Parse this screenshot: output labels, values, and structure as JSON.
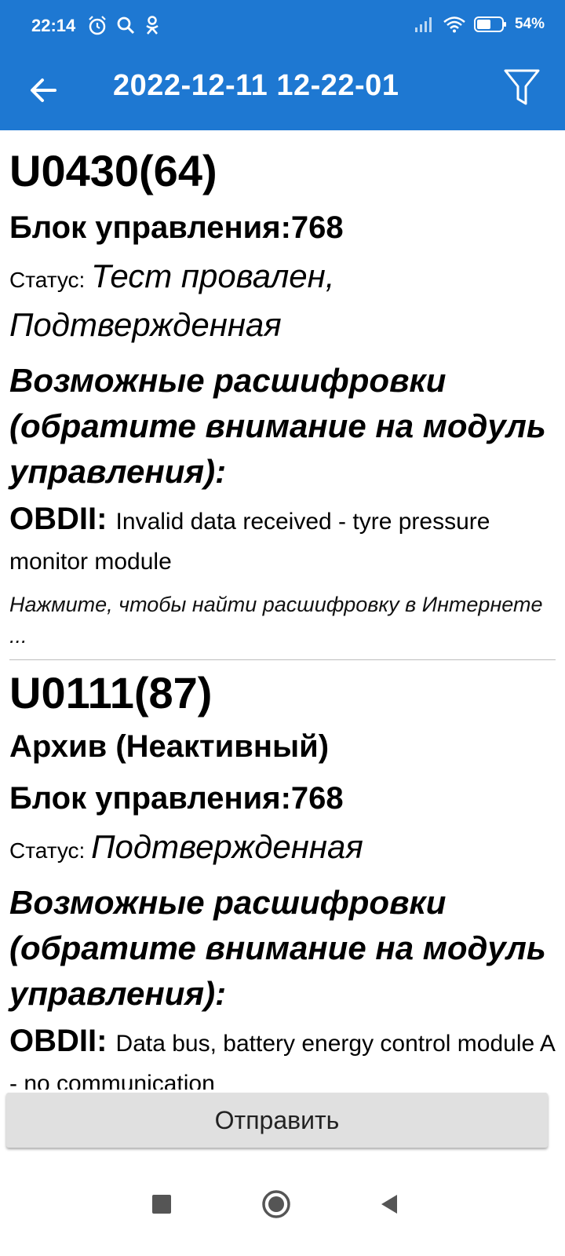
{
  "status_bar": {
    "time": "22:14",
    "battery_percent": "54%",
    "icons_left": [
      "alarm-icon",
      "search-icon",
      "odnoklassniki-icon"
    ],
    "icons_right": [
      "signal-icon",
      "wifi-icon",
      "battery-icon"
    ]
  },
  "app_bar": {
    "title": "2022-12-11 12-22-01",
    "back_icon": "arrow-left-icon",
    "filter_icon": "filter-icon",
    "color": "#1e78d2"
  },
  "entries": [
    {
      "code": "U0430(64)",
      "block": "Блок управления:768",
      "status_label": "Статус: ",
      "status_value": "Тест провален, Подтвержденная",
      "possible_title": "Возможные расшифровки (обратите внимание на модуль управления):",
      "obd_label": "OBDII: ",
      "obd_text": "Invalid data received - tyre pressure monitor module",
      "hint": "Нажмите, чтобы найти расшифровку в Интернете ..."
    },
    {
      "code": "U0111(87)",
      "archive": "Архив (Неактивный)",
      "block": "Блок управления:768",
      "status_label": "Статус: ",
      "status_value": "Подтвержденная",
      "possible_title": "Возможные расшифровки (обратите внимание на модуль управления):",
      "obd_label": "OBDII: ",
      "obd_text": "Data bus, battery energy control module A - no communication"
    }
  ],
  "send_button": {
    "label": "Отправить"
  },
  "nav_bar": {
    "icons": [
      "recents-square-icon",
      "home-circle-icon",
      "back-triangle-icon"
    ]
  }
}
